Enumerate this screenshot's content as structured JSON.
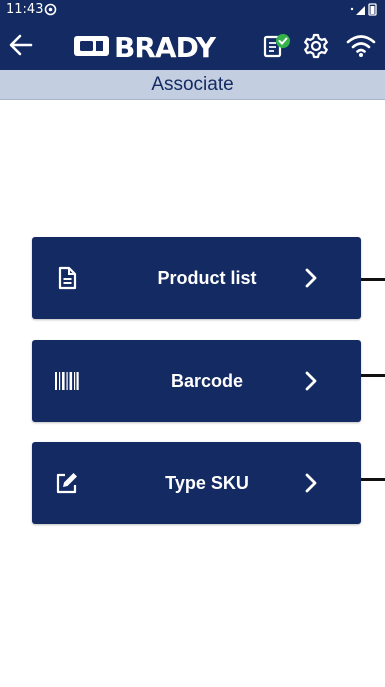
{
  "status_bar": {
    "time": "11:43"
  },
  "app_bar": {
    "brand": "BRADY"
  },
  "subheader": {
    "title": "Associate"
  },
  "menu": {
    "items": [
      {
        "label": "Product list",
        "icon": "document-list-icon"
      },
      {
        "label": "Barcode",
        "icon": "barcode-icon"
      },
      {
        "label": "Type SKU",
        "icon": "edit-icon"
      }
    ]
  },
  "colors": {
    "primary": "#142a63",
    "subheader_bg": "#c3cfe0",
    "check_green": "#35b24a"
  }
}
